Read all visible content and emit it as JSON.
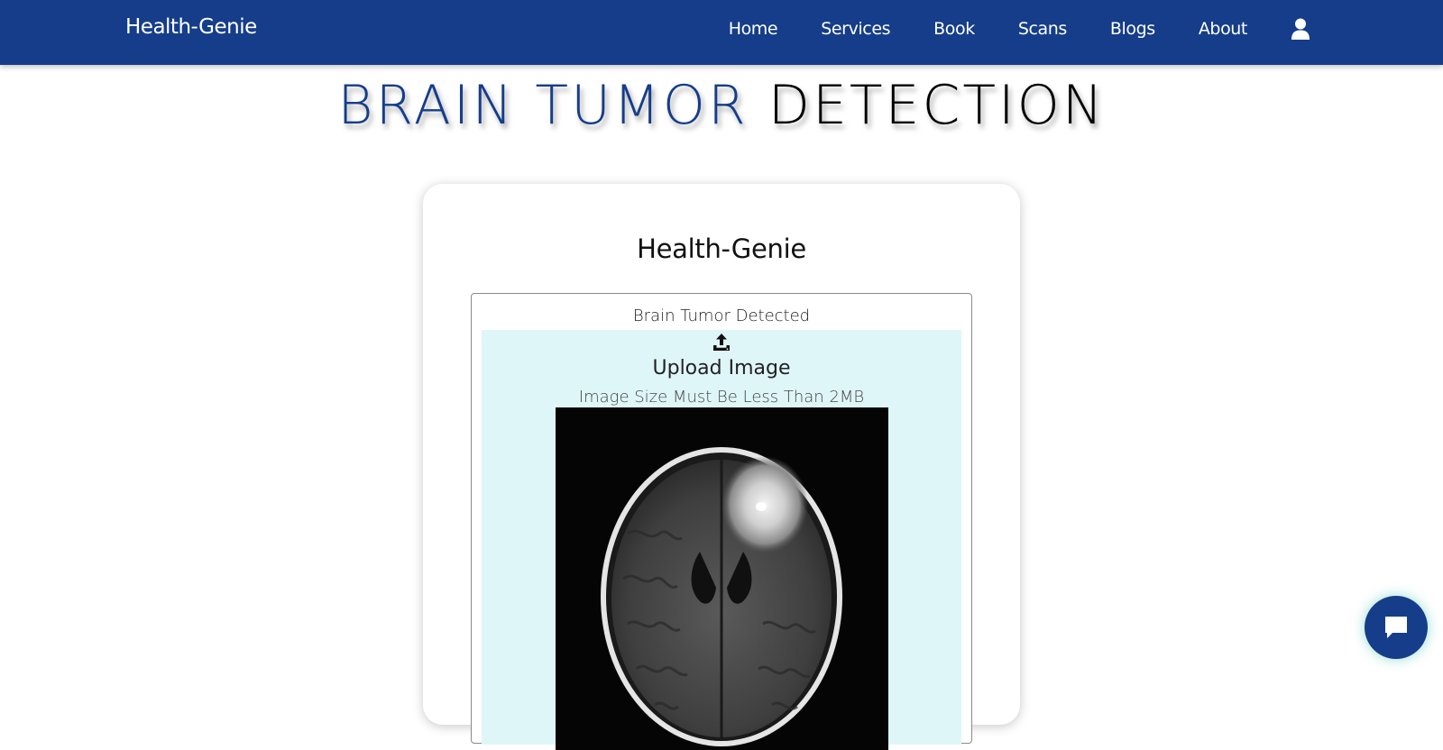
{
  "header": {
    "brand": "Health-Genie",
    "nav": [
      "Home",
      "Services",
      "Book",
      "Scans",
      "Blogs",
      "About"
    ],
    "user_icon": "user-icon"
  },
  "page": {
    "title_accent": "BRAIN TUMOR",
    "title_rest": "DETECTION"
  },
  "card": {
    "title": "Health-Genie",
    "result": "Brain Tumor Detected",
    "upload_icon": "upload-icon",
    "upload_label": "Upload Image",
    "size_hint": "Image Size Must Be Less Than 2MB",
    "scan_image": "brain-mri-scan"
  },
  "chat": {
    "icon": "chat-bubble-icon"
  },
  "colors": {
    "brand": "#153d8a",
    "drop_zone": "#dff6f9",
    "title_dark": "#000000"
  }
}
